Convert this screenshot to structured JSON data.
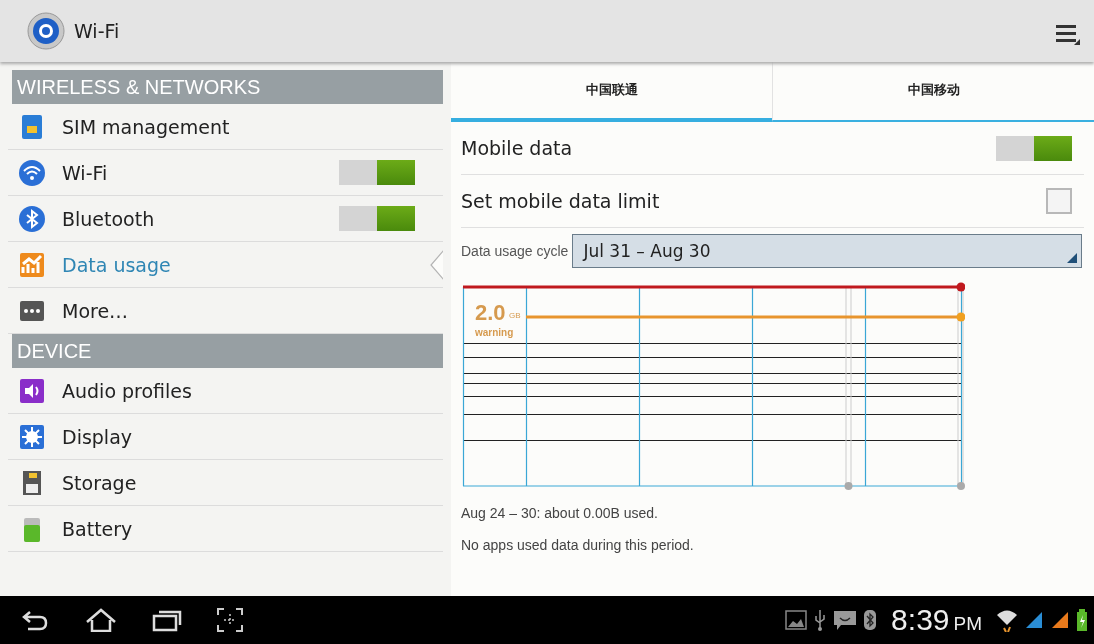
{
  "action_bar": {
    "title": "Wi-Fi"
  },
  "sidebar": {
    "sections": [
      {
        "header": "WIRELESS & NETWORKS",
        "items": [
          {
            "label": "SIM management",
            "kind": "plain",
            "selected": false
          },
          {
            "label": "Wi-Fi",
            "kind": "switch",
            "on": true,
            "selected": false
          },
          {
            "label": "Bluetooth",
            "kind": "switch",
            "on": true,
            "selected": false
          },
          {
            "label": "Data usage",
            "kind": "plain",
            "selected": true
          },
          {
            "label": "More…",
            "kind": "plain",
            "selected": false
          }
        ]
      },
      {
        "header": "DEVICE",
        "items": [
          {
            "label": "Audio profiles",
            "kind": "plain",
            "selected": false
          },
          {
            "label": "Display",
            "kind": "plain",
            "selected": false
          },
          {
            "label": "Storage",
            "kind": "plain",
            "selected": false
          },
          {
            "label": "Battery",
            "kind": "plain",
            "selected": false
          }
        ]
      }
    ]
  },
  "tabs": [
    {
      "label": "中国联通",
      "selected": true
    },
    {
      "label": "中国移动",
      "selected": false
    }
  ],
  "mobile_data": {
    "label": "Mobile data",
    "on": true
  },
  "data_limit": {
    "label": "Set mobile data limit",
    "checked": false
  },
  "usage_cycle": {
    "label": "Data usage cycle",
    "value": "Jul 31 – Aug 30"
  },
  "chart": {
    "warning_value": "2.0",
    "warning_unit": "GB",
    "warning_label": "warning"
  },
  "summary": "Aug 24 – 30: about 0.00B used.",
  "note": "No apps used data during this period.",
  "status_bar": {
    "time": "8:39",
    "period": "PM"
  }
}
